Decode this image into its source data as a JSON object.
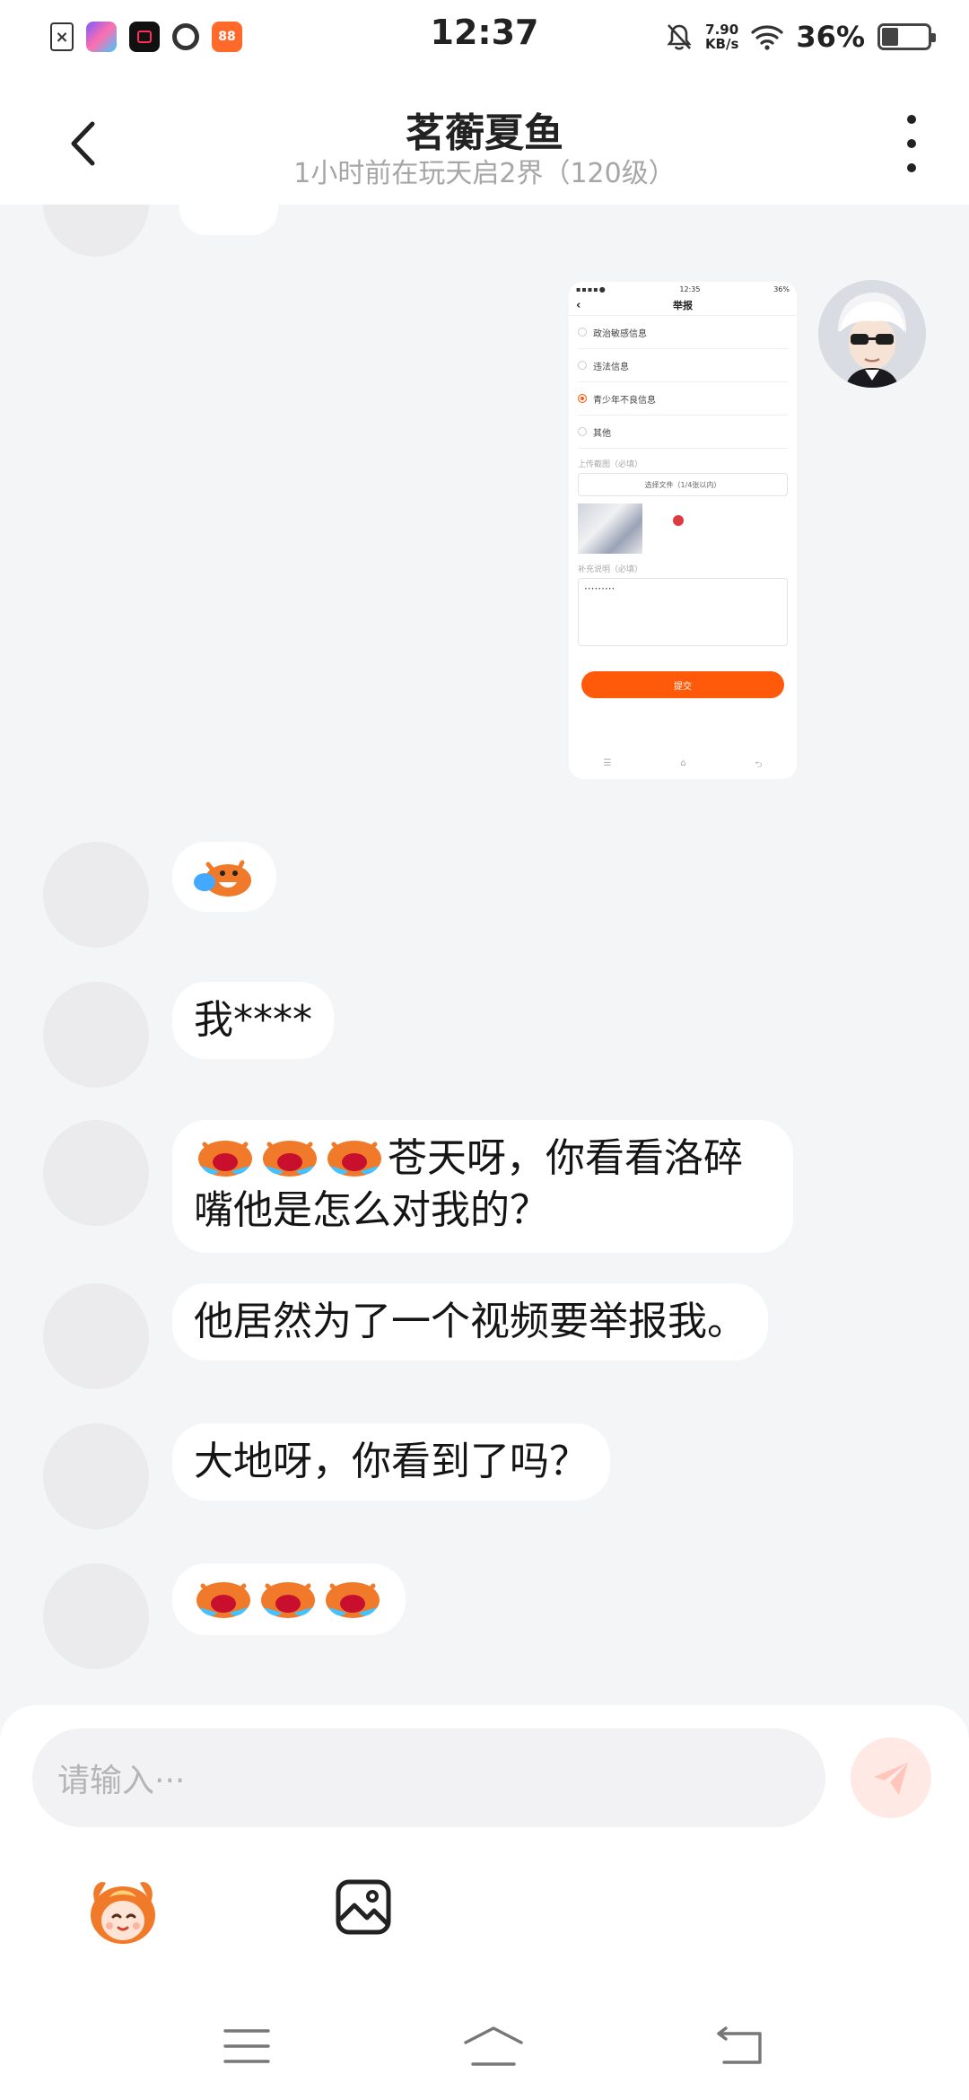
{
  "status_bar": {
    "time": "12:37",
    "network_speed": "7.90",
    "network_unit": "KB/s",
    "battery_percent": "36%",
    "battery_level": 0.36,
    "apps": [
      "file-x-icon",
      "game-app-icon",
      "video-app-icon",
      "browser-q-icon",
      "shop-app-icon"
    ]
  },
  "header": {
    "title": "茗蘅夏鱼",
    "subtitle": "1小时前在玩天启2界（120级）"
  },
  "shared_screenshot": {
    "status_time": "12:35",
    "status_battery": "36%",
    "title": "举报",
    "options": [
      {
        "label": "政治敏感信息",
        "selected": false
      },
      {
        "label": "违法信息",
        "selected": false
      },
      {
        "label": "青少年不良信息",
        "selected": true
      },
      {
        "label": "其他",
        "selected": false
      }
    ],
    "evidence_label": "上传截图（必填）",
    "upload_label": "选择文件（1/4张以内）",
    "detail_label": "补充说明（必填）",
    "detail_value": "·········",
    "submit_label": "提交"
  },
  "messages": [
    {
      "id": "m1",
      "type": "sticker",
      "count": 1
    },
    {
      "id": "m2",
      "type": "text",
      "text": "我****"
    },
    {
      "id": "m3",
      "type": "text",
      "stickers": 3,
      "line1": "苍天呀，你看看洛碎",
      "line2": "嘴他是怎么对我的？"
    },
    {
      "id": "m4",
      "type": "text",
      "text": "他居然为了一个视频要举报我。"
    },
    {
      "id": "m5",
      "type": "text",
      "text": "大地呀，你看到了吗？"
    },
    {
      "id": "m6",
      "type": "sticker",
      "count": 3
    }
  ],
  "composer": {
    "placeholder": "请输入···"
  },
  "icons": {
    "back": "chevron-left-icon",
    "more": "more-vertical-icon",
    "send": "paper-plane-icon",
    "emoji": "mascot-emoji-icon",
    "image": "image-icon"
  },
  "colors": {
    "accent": "#ff5a0a",
    "send_bg": "#ffe9e4",
    "chat_bg": "#f4f5f7"
  }
}
